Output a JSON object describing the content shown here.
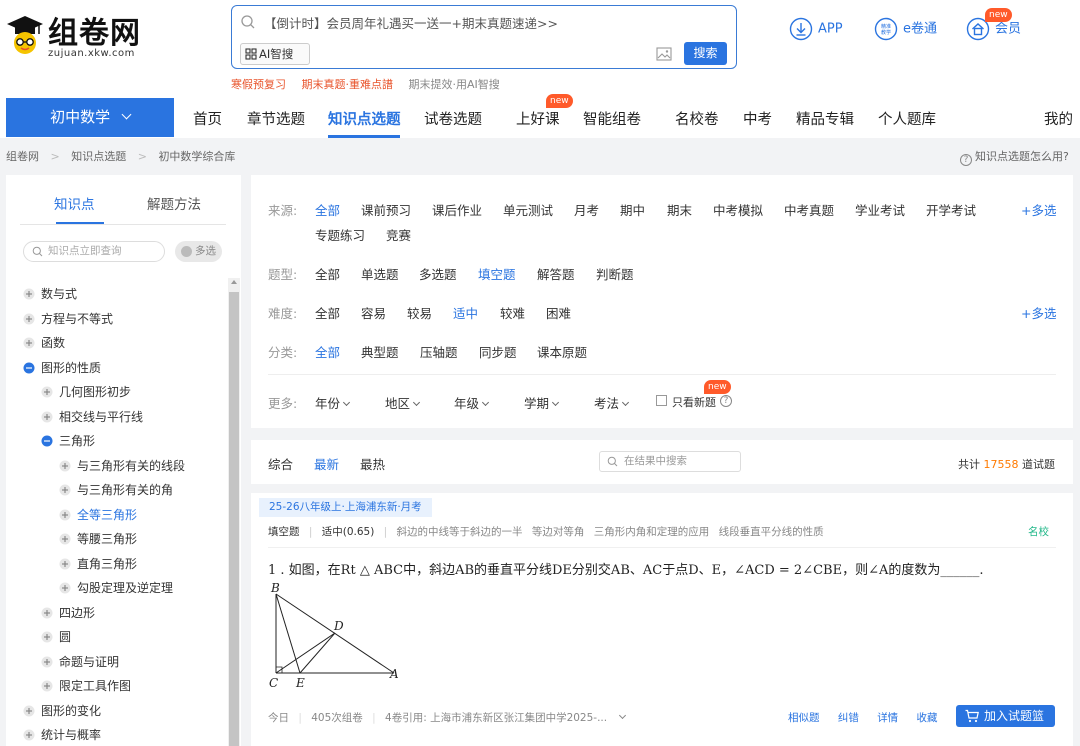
{
  "logo": {
    "title": "组卷网",
    "url": "zujuan.xkw.com"
  },
  "search": {
    "placeholder": "【倒计时】会员周年礼遇买一送一+期末真题速递>>",
    "ai_chip": "AI智搜",
    "button": "搜索",
    "hot_links": [
      {
        "text": "寒假预复习",
        "color": "red"
      },
      {
        "text": "期末真题·重难点譜",
        "color": "red"
      },
      {
        "text": "期末提效·用AI智搜",
        "color": "gray"
      }
    ]
  },
  "top_actions": {
    "app": "APP",
    "ejuantong": "e卷通",
    "member": "会员",
    "member_badge": "new",
    "ejuantong_icon_text": "精准教学"
  },
  "nav": {
    "subject": "初中数学",
    "items": [
      "首页",
      "章节选题",
      "知识点选题",
      "试卷选题",
      "上好课",
      "智能组卷",
      "名校卷",
      "中考",
      "精品专辑",
      "个人题库",
      "我的"
    ],
    "active": "知识点选题",
    "badge": "new"
  },
  "breadcrumb": [
    "组卷网",
    ">",
    "知识点选题",
    ">",
    "初中数学综合库"
  ],
  "help": "知识点选题怎么用?",
  "sidebar": {
    "tabs": [
      "知识点",
      "解题方法"
    ],
    "search_placeholder": "知识点立即查询",
    "multi": "多选",
    "tree": [
      {
        "label": "数与式",
        "level": 0,
        "icon": "plus"
      },
      {
        "label": "方程与不等式",
        "level": 0,
        "icon": "plus"
      },
      {
        "label": "函数",
        "level": 0,
        "icon": "plus"
      },
      {
        "label": "图形的性质",
        "level": 0,
        "icon": "minus"
      },
      {
        "label": "几何图形初步",
        "level": 1,
        "icon": "plus"
      },
      {
        "label": "相交线与平行线",
        "level": 1,
        "icon": "plus"
      },
      {
        "label": "三角形",
        "level": 1,
        "icon": "minus"
      },
      {
        "label": "与三角形有关的线段",
        "level": 2,
        "icon": "plus"
      },
      {
        "label": "与三角形有关的角",
        "level": 2,
        "icon": "plus"
      },
      {
        "label": "全等三角形",
        "level": 2,
        "icon": "plus",
        "active": true
      },
      {
        "label": "等腰三角形",
        "level": 2,
        "icon": "plus"
      },
      {
        "label": "直角三角形",
        "level": 2,
        "icon": "plus"
      },
      {
        "label": "勾股定理及逆定理",
        "level": 2,
        "icon": "plus"
      },
      {
        "label": "四边形",
        "level": 1,
        "icon": "plus"
      },
      {
        "label": "圆",
        "level": 1,
        "icon": "plus"
      },
      {
        "label": "命题与证明",
        "level": 1,
        "icon": "plus"
      },
      {
        "label": "限定工具作图",
        "level": 1,
        "icon": "plus"
      },
      {
        "label": "图形的变化",
        "level": 0,
        "icon": "plus"
      },
      {
        "label": "统计与概率",
        "level": 0,
        "icon": "plus"
      }
    ]
  },
  "filters": {
    "source": {
      "label": "来源:",
      "options": [
        "全部",
        "课前预习",
        "课后作业",
        "单元测试",
        "月考",
        "期中",
        "期末",
        "中考模拟",
        "中考真题",
        "学业考试",
        "开学考试",
        "专题练习",
        "竞赛"
      ],
      "selected": "全部",
      "more": "+多选"
    },
    "type": {
      "label": "题型:",
      "options": [
        "全部",
        "单选题",
        "多选题",
        "填空题",
        "解答题",
        "判断题"
      ],
      "selected": "填空题"
    },
    "difficulty": {
      "label": "难度:",
      "options": [
        "全部",
        "容易",
        "较易",
        "适中",
        "较难",
        "困难"
      ],
      "selected": "适中",
      "more": "+多选"
    },
    "category": {
      "label": "分类:",
      "options": [
        "全部",
        "典型题",
        "压轴题",
        "同步题",
        "课本原题"
      ],
      "selected": "全部"
    },
    "more": {
      "label": "更多:",
      "dropdowns": [
        "年份",
        "地区",
        "年级",
        "学期",
        "考法"
      ],
      "checkbox": "只看新题",
      "badge": "new"
    }
  },
  "sort": {
    "options": [
      "综合",
      "最新",
      "最热"
    ],
    "selected": "最新",
    "search_placeholder": "在结果中搜索",
    "total_prefix": "共计",
    "total": "17558",
    "total_suffix": "道试题"
  },
  "question": {
    "tag": "25-26八年级上·上海浦东新·月考",
    "type": "填空题",
    "difficulty": "适中(0.65)",
    "knowledge": [
      "斜边的中线等于斜边的一半",
      "等边对等角",
      "三角形内角和定理的应用",
      "线段垂直平分线的性质"
    ],
    "famous": "名校",
    "text": "1 . 如图，在Rt △ ABC中，斜边AB的垂直平分线DE分别交AB、AC于点D、E，∠ACD = 2∠CBE，则∠A的度数为______.",
    "figure_labels": {
      "B": "B",
      "D": "D",
      "C": "C",
      "E": "E",
      "A": "A"
    },
    "footer": {
      "date": "今日",
      "uses": "405次组卷",
      "cited": "4卷引用: 上海市浦东新区张江集团中学2025-..."
    },
    "actions": [
      "相似题",
      "纠错",
      "详情",
      "收藏"
    ],
    "add_button": "加入试题篮"
  },
  "colors": {
    "primary": "#2a74e0",
    "accent_red": "#e8532b",
    "count": "#ff7a00",
    "famous": "#23b88a"
  }
}
